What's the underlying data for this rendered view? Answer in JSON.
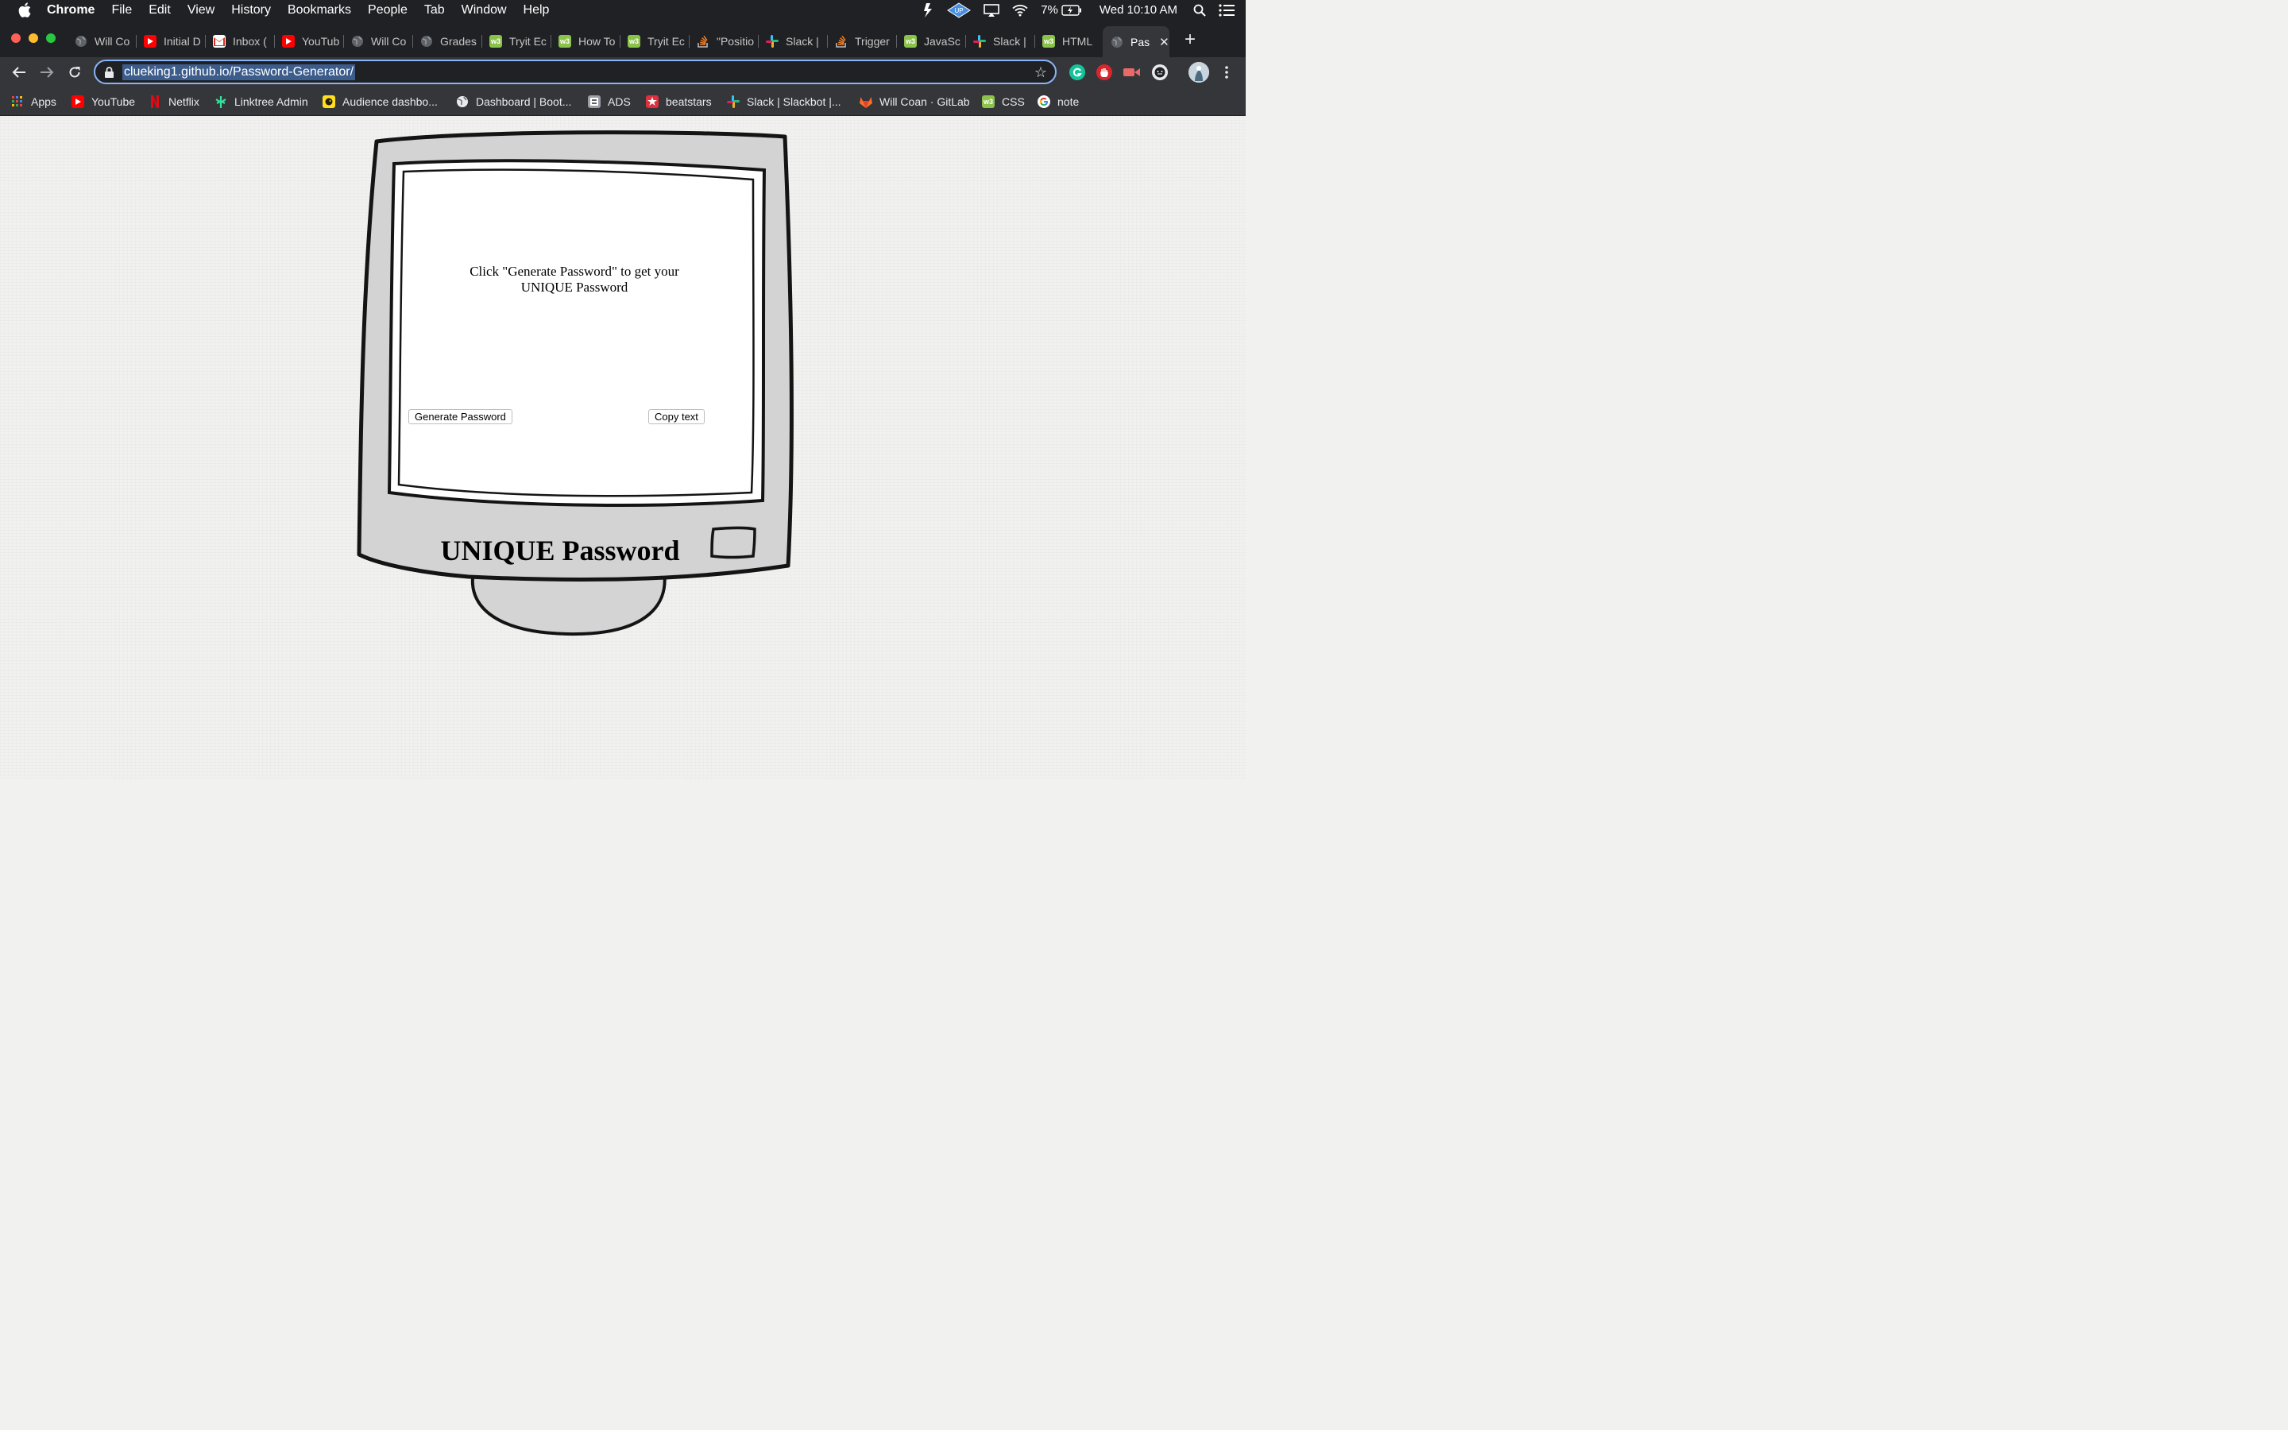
{
  "menubar": {
    "app_name": "Chrome",
    "items": [
      "File",
      "Edit",
      "View",
      "History",
      "Bookmarks",
      "People",
      "Tab",
      "Window",
      "Help"
    ],
    "battery": "7%",
    "clock": "Wed 10:10 AM"
  },
  "tabs": [
    {
      "label": "Will Co",
      "icon": "globe-icon"
    },
    {
      "label": "Initial D",
      "icon": "youtube-icon"
    },
    {
      "label": "Inbox (",
      "icon": "gmail-icon"
    },
    {
      "label": "YouTub",
      "icon": "youtube-icon"
    },
    {
      "label": "Will Co",
      "icon": "globe-icon"
    },
    {
      "label": "Grades",
      "icon": "globe-icon"
    },
    {
      "label": "Tryit Ec",
      "icon": "w3schools-icon"
    },
    {
      "label": "How To",
      "icon": "w3schools-icon"
    },
    {
      "label": "Tryit Ec",
      "icon": "w3schools-icon"
    },
    {
      "label": "\"Positio",
      "icon": "stackoverflow-icon"
    },
    {
      "label": "Slack |",
      "icon": "slack-icon"
    },
    {
      "label": "Trigger",
      "icon": "stackoverflow-icon"
    },
    {
      "label": "JavaSc",
      "icon": "w3schools-icon"
    },
    {
      "label": "Slack |",
      "icon": "slack-icon"
    },
    {
      "label": "HTML",
      "icon": "w3schools-icon"
    }
  ],
  "active_tab": {
    "label": "Pas",
    "icon": "globe-icon"
  },
  "address": {
    "url": "clueking1.github.io/Password-Generator/"
  },
  "bookmarks": [
    {
      "label": "Apps",
      "icon": "apps-grid-icon"
    },
    {
      "label": "YouTube",
      "icon": "youtube-icon"
    },
    {
      "label": "Netflix",
      "icon": "netflix-icon"
    },
    {
      "label": "Linktree Admin",
      "icon": "linktree-icon"
    },
    {
      "label": "Audience dashbo...",
      "icon": "mailchimp-icon"
    },
    {
      "label": "Dashboard | Boot...",
      "icon": "globe-icon"
    },
    {
      "label": "ADS",
      "icon": "ads-icon"
    },
    {
      "label": "beatstars",
      "icon": "beatstars-icon"
    },
    {
      "label": "Slack | Slackbot |...",
      "icon": "slack-icon"
    },
    {
      "label": "Will Coan · GitLab",
      "icon": "gitlab-icon"
    },
    {
      "label": "CSS",
      "icon": "w3schools-icon"
    },
    {
      "label": "note",
      "icon": "google-icon"
    }
  ],
  "page": {
    "prompt": "Click \"Generate Password\" to get your UNIQUE Password",
    "generate_label": "Generate Password",
    "copy_label": "Copy text",
    "brand": "UNIQUE Password"
  },
  "colors": {
    "chrome_dark": "#202124",
    "chrome_toolbar": "#35363a",
    "omnibox_focus": "#8ab4f8",
    "monitor_body": "#d4d4d4",
    "page_background": "#f1f1f0"
  }
}
